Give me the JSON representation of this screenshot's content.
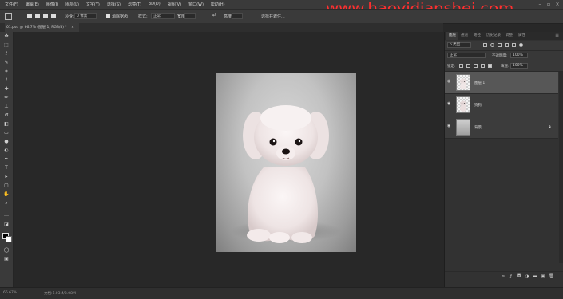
{
  "menubar": {
    "items": [
      "文件(F)",
      "编辑(E)",
      "图像(I)",
      "图层(L)",
      "文字(Y)",
      "选择(S)",
      "滤镜(T)",
      "3D(D)",
      "视图(V)",
      "窗口(W)",
      "帮助(H)"
    ],
    "watermark": "www.haoyidianshei.com"
  },
  "options": {
    "feather_label": "羽化:",
    "feather_value": "0 像素",
    "antialias_label": "消除锯齿",
    "style_label": "样式:",
    "style_value": "正常",
    "width_label": "宽度:",
    "height_label": "高度:",
    "select_mask": "选择并遮住..."
  },
  "document": {
    "tab_title": "01.psd @ 66.7% (图层 1, RGB/8) *",
    "close_glyph": "×"
  },
  "status": {
    "zoom": "66.67%",
    "doc_info": "文档:1.03M/3.08M"
  },
  "panels": {
    "tabs": [
      "图层",
      "通道",
      "路径",
      "历史记录",
      "调整",
      "属性"
    ],
    "active_tab": "图层",
    "filter_kind": "ρ 类型",
    "blend_mode": "正常",
    "opacity_label": "不透明度:",
    "opacity_value": "100%",
    "lock_label": "锁定:",
    "fill_label": "填充:",
    "fill_value": "100%"
  },
  "layers": [
    {
      "name": "图层 1",
      "selected": true,
      "visible": true,
      "thumb": "transparent-dog"
    },
    {
      "name": "狗狗",
      "selected": false,
      "visible": true,
      "thumb": "transparent-dog"
    },
    {
      "name": "背景",
      "selected": false,
      "visible": true,
      "thumb": "gray",
      "locked": true
    }
  ],
  "colors": {
    "watermark": "#ff2f2f",
    "ui_dark": "#3a3a3a",
    "canvas_bg": "#282828",
    "selected_layer": "#575757"
  },
  "icons": {
    "eye": "eye-icon",
    "lock": "lock-icon"
  }
}
